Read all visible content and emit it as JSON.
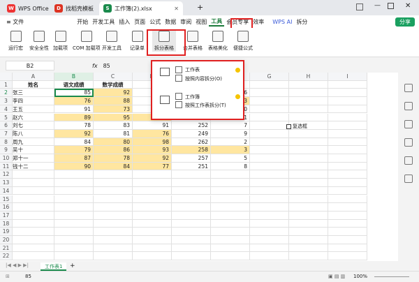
{
  "tabs": [
    {
      "label": "WPS Office",
      "color": "#e33"
    },
    {
      "label": "找稻壳模板",
      "color": "#d32"
    },
    {
      "label": "工作簿(2).xlsx",
      "color": "#1a8a4c"
    }
  ],
  "new_tab": "+",
  "menu": {
    "file": "≡ 文件",
    "items": [
      "开始",
      "开发工具",
      "插入",
      "页面",
      "公式",
      "数据",
      "审阅",
      "视图",
      "工具",
      "会员专享",
      "效率"
    ],
    "wps_ai": "WPS AI",
    "split": "拆分",
    "share": "分享"
  },
  "ribbon": {
    "buttons": [
      "运行宏",
      "安全全性",
      "加载项",
      "COM 加载项",
      "开发工具",
      "记录单",
      "拆分表格",
      "合并表格",
      "表格美化",
      "便捷公式"
    ]
  },
  "formula_bar": {
    "cell_ref": "B2",
    "fx": "fx",
    "value": "85"
  },
  "columns": [
    "A",
    "B",
    "C",
    "D",
    "E",
    "F",
    "G",
    "H",
    "I"
  ],
  "rows": [
    "1",
    "2",
    "3",
    "4",
    "5",
    "6",
    "7",
    "8",
    "9",
    "10",
    "11",
    "12",
    "13",
    "14",
    "15",
    "16",
    "17",
    "18",
    "19",
    "20",
    "21",
    "22"
  ],
  "table": {
    "headers": [
      "姓名",
      "语文成绩",
      "数学成绩",
      "",
      "",
      "名"
    ],
    "data": [
      [
        "张三",
        "85",
        "92",
        "",
        "",
        "6"
      ],
      [
        "李四",
        "76",
        "88",
        "",
        "",
        "3"
      ],
      [
        "王五",
        "91",
        "73",
        "",
        "",
        "10"
      ],
      [
        "赵六",
        "89",
        "95",
        "87",
        "271",
        "1"
      ],
      [
        "刘七",
        "78",
        "83",
        "91",
        "252",
        "7"
      ],
      [
        "陈八",
        "92",
        "81",
        "76",
        "249",
        "9"
      ],
      [
        "周九",
        "84",
        "80",
        "98",
        "262",
        "2"
      ],
      [
        "吴十",
        "79",
        "86",
        "93",
        "258",
        "3"
      ],
      [
        "郑十一",
        "87",
        "78",
        "92",
        "257",
        "5"
      ],
      [
        "钱十二",
        "90",
        "84",
        "77",
        "251",
        "8"
      ]
    ]
  },
  "checkbox_label": "复选框",
  "dropdown": {
    "items": [
      {
        "title": "工作表",
        "desc": "按照内容拆分(O)"
      },
      {
        "title": "工作簿",
        "desc": "按照工作表拆分(T)"
      }
    ]
  },
  "sheet_tab": "工作表1",
  "status": {
    "value": "85",
    "zoom": "100%"
  }
}
